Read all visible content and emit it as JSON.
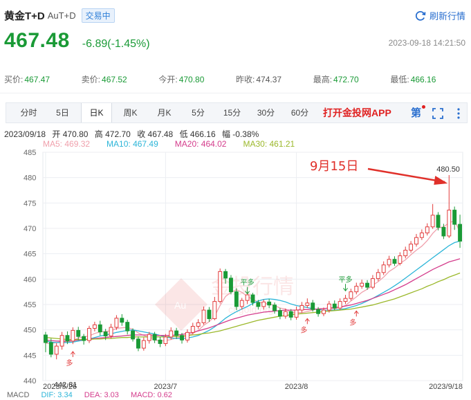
{
  "header": {
    "name": "黄金T+D",
    "code": "AuT+D",
    "badge": "交易中",
    "refresh_label": "刷新行情"
  },
  "price": {
    "last": "467.48",
    "change": "-6.89(-1.45%)",
    "timestamp": "2023-09-18 14:21:50"
  },
  "quotes": [
    {
      "label": "买价:",
      "value": "467.47",
      "color": "green"
    },
    {
      "label": "卖价:",
      "value": "467.52",
      "color": "green"
    },
    {
      "label": "今开:",
      "value": "470.80",
      "color": "green"
    },
    {
      "label": "昨收:",
      "value": "474.37",
      "color": "gray"
    },
    {
      "label": "最高:",
      "value": "472.70",
      "color": "green"
    },
    {
      "label": "最低:",
      "value": "466.16",
      "color": "green"
    }
  ],
  "toolbar": {
    "tabs": [
      "分时",
      "5日",
      "日K",
      "周K",
      "月K",
      "5分",
      "15分",
      "30分",
      "60分"
    ],
    "active_tab": "日K",
    "app_link": "打开金投网APP",
    "draw_icon_glyph": "第"
  },
  "ohlc_info": {
    "date": "2023/09/18",
    "open": "开 470.80",
    "high": "高 472.70",
    "close": "收 467.48",
    "low": "低 466.16",
    "amplitude": "幅 -0.38%"
  },
  "ma_info": [
    {
      "label": "MA5: 469.32",
      "color": "#f0a0ac"
    },
    {
      "label": "MA10: 467.49",
      "color": "#2bb5d8"
    },
    {
      "label": "MA20: 464.02",
      "color": "#d43c8c"
    },
    {
      "label": "MA30: 461.21",
      "color": "#9bb82a"
    }
  ],
  "annotations": {
    "date_callout": "9月15日",
    "peak_label": "480.50",
    "low_label": "442.81",
    "markers": [
      "平多",
      "平多",
      "多",
      "多",
      "多"
    ]
  },
  "watermark": {
    "text": "金投行情",
    "sub": "cngold.org",
    "logo": "Au"
  },
  "macd": {
    "title": "MACD",
    "dif": "DIF: 3.34",
    "dea": "DEA: 3.03",
    "macd": "MACD: 0.62",
    "colors": {
      "dif": "#2bb5d8",
      "dea": "#d43c8c",
      "macd": "#d43c8c"
    }
  },
  "colors": {
    "up": "#e23b3b",
    "down": "#1a9a36",
    "accent": "#2a6fcf",
    "ma_green": "#9bb82a"
  },
  "chart_data": {
    "type": "candlestick",
    "y_ticks": [
      440,
      445,
      450,
      455,
      460,
      465,
      470,
      475,
      480,
      485
    ],
    "ylim": [
      440,
      485
    ],
    "x_labels": [
      "2023/5/26",
      "2023/7",
      "2023/8",
      "2023/9/18"
    ],
    "x_label_positions": [
      0,
      22,
      46,
      79
    ],
    "candles": [
      [
        449.0,
        447.5,
        449.6,
        445.6
      ],
      [
        447.5,
        445.2,
        448.3,
        444.6
      ],
      [
        445.2,
        446.8,
        447.4,
        444.2
      ],
      [
        446.8,
        448.9,
        449.6,
        446.1
      ],
      [
        448.9,
        447.8,
        449.7,
        447.2
      ],
      [
        447.8,
        449.9,
        450.5,
        447.2
      ],
      [
        449.9,
        448.7,
        450.6,
        448.0
      ],
      [
        448.7,
        447.9,
        449.2,
        447.1
      ],
      [
        447.9,
        450.3,
        450.8,
        447.4
      ],
      [
        450.3,
        451.0,
        451.6,
        449.7
      ],
      [
        451.0,
        449.6,
        451.8,
        448.9
      ],
      [
        449.6,
        448.8,
        450.2,
        448.0
      ],
      [
        448.8,
        450.5,
        451.2,
        448.3
      ],
      [
        450.5,
        452.3,
        452.9,
        450.0
      ],
      [
        452.3,
        451.5,
        453.1,
        450.8
      ],
      [
        451.5,
        449.8,
        452.0,
        449.1
      ],
      [
        449.8,
        448.2,
        450.3,
        447.7
      ],
      [
        448.2,
        446.4,
        448.7,
        445.8
      ],
      [
        446.4,
        447.9,
        448.5,
        445.9
      ],
      [
        447.9,
        449.1,
        449.6,
        447.3
      ],
      [
        449.1,
        448.0,
        449.6,
        447.4
      ],
      [
        448.0,
        447.3,
        448.6,
        446.6
      ],
      [
        447.3,
        448.6,
        449.2,
        446.8
      ],
      [
        448.6,
        449.8,
        450.5,
        448.1
      ],
      [
        449.8,
        448.9,
        450.4,
        448.2
      ],
      [
        448.9,
        448.0,
        449.4,
        447.3
      ],
      [
        448.0,
        449.5,
        450.1,
        447.5
      ],
      [
        449.5,
        450.7,
        451.4,
        449.1
      ],
      [
        450.7,
        451.4,
        452.1,
        450.2
      ],
      [
        451.4,
        453.9,
        454.6,
        451.0
      ],
      [
        453.9,
        452.2,
        454.5,
        451.6
      ],
      [
        452.2,
        455.6,
        456.5,
        451.9
      ],
      [
        455.6,
        461.5,
        462.1,
        455.2
      ],
      [
        461.5,
        460.2,
        462.0,
        459.1
      ],
      [
        460.2,
        457.5,
        460.8,
        457.0
      ],
      [
        457.5,
        454.6,
        458.2,
        453.9
      ],
      [
        454.6,
        455.8,
        456.3,
        454.0
      ],
      [
        455.8,
        456.9,
        457.5,
        455.1
      ],
      [
        456.9,
        455.4,
        457.3,
        454.8
      ],
      [
        455.4,
        454.6,
        455.9,
        454.0
      ],
      [
        454.6,
        455.5,
        456.0,
        454.0
      ],
      [
        455.5,
        454.9,
        456.1,
        454.3
      ],
      [
        454.9,
        453.8,
        455.4,
        453.2
      ],
      [
        453.8,
        452.7,
        454.3,
        452.1
      ],
      [
        452.7,
        453.6,
        454.2,
        452.2
      ],
      [
        453.6,
        452.5,
        454.1,
        451.9
      ],
      [
        452.5,
        453.9,
        454.6,
        452.0
      ],
      [
        453.9,
        454.8,
        455.5,
        453.4
      ],
      [
        454.8,
        455.3,
        456.2,
        454.3
      ],
      [
        455.3,
        454.0,
        455.9,
        453.6
      ],
      [
        454.0,
        453.2,
        454.5,
        452.6
      ],
      [
        453.2,
        453.9,
        454.4,
        452.7
      ],
      [
        453.9,
        455.1,
        455.7,
        453.4
      ],
      [
        455.1,
        454.3,
        455.8,
        453.9
      ],
      [
        454.3,
        455.6,
        456.2,
        453.9
      ],
      [
        455.6,
        456.2,
        456.9,
        455.1
      ],
      [
        456.2,
        457.5,
        458.1,
        455.8
      ],
      [
        457.5,
        458.6,
        459.3,
        457.0
      ],
      [
        458.6,
        459.2,
        459.9,
        458.1
      ],
      [
        459.2,
        458.4,
        459.8,
        457.9
      ],
      [
        458.4,
        460.1,
        460.8,
        458.0
      ],
      [
        460.1,
        461.3,
        462.0,
        459.6
      ],
      [
        461.3,
        462.8,
        463.5,
        460.8
      ],
      [
        462.8,
        463.9,
        464.6,
        462.3
      ],
      [
        463.9,
        463.1,
        464.5,
        462.6
      ],
      [
        463.1,
        464.6,
        465.3,
        462.7
      ],
      [
        464.6,
        465.7,
        466.4,
        464.1
      ],
      [
        465.7,
        466.9,
        467.5,
        465.2
      ],
      [
        466.9,
        468.2,
        468.9,
        466.4
      ],
      [
        468.2,
        469.1,
        469.8,
        467.7
      ],
      [
        469.1,
        470.3,
        471.0,
        468.6
      ],
      [
        470.3,
        472.6,
        474.8,
        469.9
      ],
      [
        472.6,
        470.2,
        473.2,
        469.6
      ],
      [
        470.2,
        468.5,
        470.9,
        467.9
      ],
      [
        468.5,
        473.6,
        480.5,
        468.1
      ],
      [
        473.6,
        470.8,
        474.3,
        469.7
      ],
      [
        470.8,
        467.48,
        472.7,
        466.16
      ]
    ],
    "ma": [
      {
        "name": "MA5",
        "values": [
          447.4,
          447.3,
          447.5,
          447.7,
          447.6,
          447.9,
          448.4,
          448.6,
          448.8,
          449.3,
          449.6,
          449.7,
          449.8,
          450.3,
          450.4,
          450.5,
          450.1,
          449.4,
          448.9,
          448.5,
          448.0,
          447.8,
          447.9,
          448.1,
          448.4,
          448.6,
          448.8,
          449.3,
          449.9,
          450.9,
          451.6,
          452.7,
          454.8,
          456.6,
          457.4,
          457.9,
          457.4,
          456.6,
          456.0,
          455.5,
          455.2,
          455.1,
          454.8,
          454.3,
          454.1,
          453.5,
          453.4,
          453.4,
          453.6,
          453.9,
          454.2,
          454.2,
          454.3,
          454.1,
          454.4,
          454.8,
          455.7,
          456.5,
          457.4,
          458.0,
          458.8,
          459.5,
          460.4,
          461.5,
          462.2,
          463.1,
          463.8,
          464.8,
          465.7,
          466.5,
          467.6,
          469.0,
          470.1,
          470.3,
          471.1,
          471.5,
          469.32
        ]
      },
      {
        "name": "MA10",
        "values": [
          447.8,
          447.6,
          447.5,
          447.5,
          447.5,
          447.6,
          447.8,
          448.0,
          448.2,
          448.5,
          448.8,
          449.0,
          449.2,
          449.5,
          449.7,
          449.9,
          450.0,
          449.8,
          449.6,
          449.4,
          449.2,
          448.9,
          448.6,
          448.4,
          448.3,
          448.3,
          448.4,
          448.6,
          448.9,
          449.4,
          449.9,
          450.6,
          451.4,
          452.3,
          453.0,
          453.6,
          454.1,
          454.6,
          455.2,
          455.7,
          456.0,
          456.1,
          456.0,
          455.8,
          455.5,
          455.1,
          454.8,
          454.6,
          454.4,
          454.2,
          454.0,
          453.9,
          453.9,
          453.9,
          454.0,
          454.2,
          454.5,
          454.8,
          455.2,
          455.7,
          456.2,
          456.8,
          457.4,
          458.0,
          458.7,
          459.4,
          460.2,
          461.0,
          461.8,
          462.6,
          463.4,
          464.2,
          465.0,
          465.8,
          466.6,
          467.2,
          467.49
        ]
      },
      {
        "name": "MA20",
        "values": [
          448.0,
          447.9,
          447.8,
          447.8,
          447.8,
          447.9,
          448.0,
          448.1,
          448.2,
          448.3,
          448.4,
          448.5,
          448.6,
          448.7,
          448.8,
          448.9,
          449.0,
          449.0,
          449.0,
          449.0,
          448.9,
          448.9,
          448.9,
          448.9,
          449.0,
          449.1,
          449.3,
          449.5,
          449.8,
          450.1,
          450.4,
          450.8,
          451.2,
          451.6,
          452.0,
          452.3,
          452.6,
          452.9,
          453.1,
          453.3,
          453.5,
          453.6,
          453.7,
          453.8,
          453.9,
          453.9,
          453.9,
          454.0,
          454.0,
          454.1,
          454.1,
          454.2,
          454.3,
          454.4,
          454.5,
          454.7,
          454.9,
          455.2,
          455.5,
          455.8,
          456.2,
          456.6,
          457.0,
          457.4,
          457.9,
          458.4,
          458.9,
          459.5,
          460.1,
          460.7,
          461.3,
          461.9,
          462.4,
          462.9,
          463.4,
          463.7,
          464.02
        ]
      },
      {
        "name": "MA30",
        "values": [
          448.5,
          448.4,
          448.3,
          448.2,
          448.1,
          448.1,
          448.1,
          448.1,
          448.1,
          448.2,
          448.2,
          448.3,
          448.3,
          448.4,
          448.5,
          448.5,
          448.6,
          448.6,
          448.6,
          448.6,
          448.6,
          448.6,
          448.6,
          448.7,
          448.7,
          448.8,
          448.9,
          449.0,
          449.1,
          449.3,
          449.4,
          449.6,
          449.8,
          450.1,
          450.4,
          450.7,
          451.0,
          451.3,
          451.6,
          451.9,
          452.1,
          452.3,
          452.5,
          452.7,
          452.8,
          453.0,
          453.1,
          453.2,
          453.3,
          453.4,
          453.5,
          453.6,
          453.7,
          453.8,
          453.9,
          454.0,
          454.1,
          454.3,
          454.5,
          454.7,
          454.9,
          455.2,
          455.5,
          455.8,
          456.1,
          456.5,
          456.9,
          457.3,
          457.7,
          458.1,
          458.6,
          459.0,
          459.5,
          459.9,
          460.4,
          460.8,
          461.21
        ]
      }
    ]
  }
}
